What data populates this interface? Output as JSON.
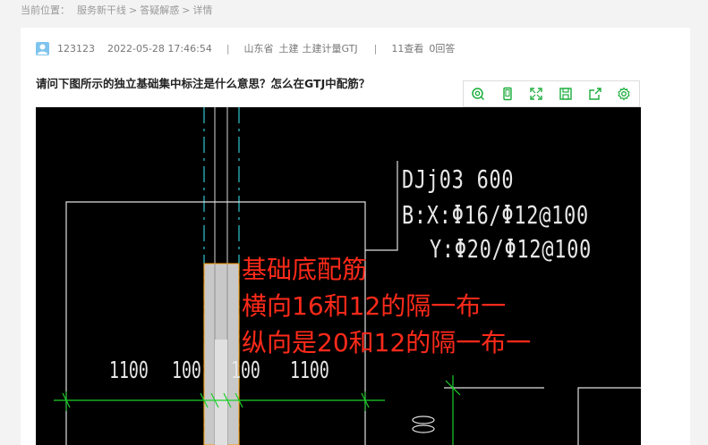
{
  "breadcrumb": {
    "prefix": "当前位置：",
    "items": [
      "服务新干线",
      "答疑解惑",
      "详情"
    ],
    "separator": ">"
  },
  "post": {
    "username": "123123",
    "time": "2022-05-28 17:46:54",
    "divider": "|",
    "region": "山东省",
    "tags": [
      "土建",
      "土建计量GTJ"
    ],
    "views": "11查看",
    "answers": "0回答",
    "title": "请问下图所示的独立基础集中标注是什么意思？怎么在GTJ中配筋？"
  },
  "toolbar": {
    "icons": [
      "search-icon",
      "mobile-icon",
      "fullscreen-icon",
      "save-icon",
      "share-icon",
      "settings-icon"
    ],
    "accent": "#1aad3b"
  },
  "drawing": {
    "label_line1": "DJj03  600",
    "label_line2": "B:X:Φ16/Φ12@100",
    "label_line3": "Y:Φ20/Φ12@100",
    "dims": [
      "1100",
      "100",
      "100",
      "1100"
    ],
    "annotation": [
      "基础底配筋",
      "横向16和12的隔一布一",
      "纵向是20和12的隔一布一"
    ],
    "annotation_color": "#ff2a1a"
  }
}
